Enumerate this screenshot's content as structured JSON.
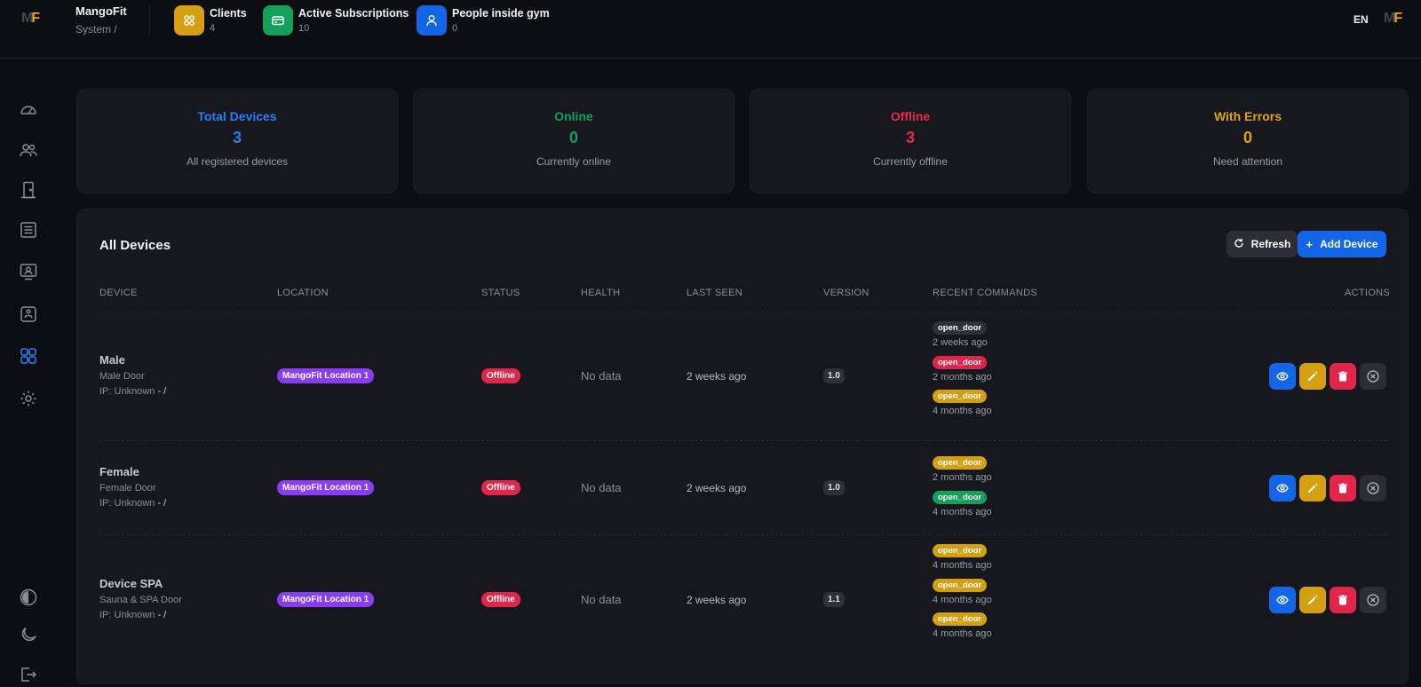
{
  "header": {
    "brand_name": "MangoFit",
    "breadcrumb": "System  /",
    "chips": [
      {
        "label": "Clients",
        "count": "4",
        "color": "#d4a012",
        "icon": "clients-icon"
      },
      {
        "label": "Active Subscriptions",
        "count": "10",
        "color": "#13a05a",
        "icon": "card-icon"
      },
      {
        "label": "People inside gym",
        "count": "0",
        "color": "#1366e8",
        "icon": "person-icon"
      }
    ],
    "language": "EN"
  },
  "sidebar": {
    "items": [
      {
        "icon": "dashboard-icon"
      },
      {
        "icon": "users-icon"
      },
      {
        "icon": "door-icon"
      },
      {
        "icon": "list-icon"
      },
      {
        "icon": "monitor-user-icon"
      },
      {
        "icon": "badge-icon"
      },
      {
        "icon": "devices-grid-icon",
        "active": true
      },
      {
        "icon": "gear-icon"
      }
    ],
    "bottom": [
      {
        "icon": "contrast-icon"
      },
      {
        "icon": "moon-icon"
      },
      {
        "icon": "logout-icon"
      }
    ]
  },
  "stats": [
    {
      "title": "Total Devices",
      "value": "3",
      "subtitle": "All registered devices",
      "color": "#2f7df6"
    },
    {
      "title": "Online",
      "value": "0",
      "subtitle": "Currently online",
      "color": "#13a05a"
    },
    {
      "title": "Offline",
      "value": "3",
      "subtitle": "Currently offline",
      "color": "#e8294d"
    },
    {
      "title": "With Errors",
      "value": "0",
      "subtitle": "Need attention",
      "color": "#e0a418"
    }
  ],
  "devices_panel": {
    "title": "All Devices",
    "refresh_label": "Refresh",
    "add_label": "Add Device",
    "columns": [
      "DEVICE",
      "LOCATION",
      "STATUS",
      "HEALTH",
      "LAST SEEN",
      "VERSION",
      "RECENT COMMANDS",
      "ACTIONS"
    ],
    "rows": [
      {
        "name": "Male",
        "desc": "Male Door",
        "ip_label": "IP: Unknown",
        "ip_suffix": "- /",
        "location": "MangoFit Location 1",
        "status": "Offline",
        "health": "No data",
        "last_seen": "2 weeks ago",
        "version": "1.0",
        "commands": [
          {
            "name": "open_door",
            "when": "2 weeks ago",
            "color": "#2f3139"
          },
          {
            "name": "open_door",
            "when": "2 months ago",
            "color": "#e0264a"
          },
          {
            "name": "open_door",
            "when": "4 months ago",
            "color": "#d4a012"
          }
        ]
      },
      {
        "name": "Female",
        "desc": "Female Door",
        "ip_label": "IP: Unknown",
        "ip_suffix": "- /",
        "location": "MangoFit Location 1",
        "status": "Offline",
        "health": "No data",
        "last_seen": "2 weeks ago",
        "version": "1.0",
        "commands": [
          {
            "name": "open_door",
            "when": "2 months ago",
            "color": "#d4a012"
          },
          {
            "name": "open_door",
            "when": "4 months ago",
            "color": "#13a05a"
          }
        ]
      },
      {
        "name": "Device SPA",
        "desc": "Sauna & SPA Door",
        "ip_label": "IP: Unknown",
        "ip_suffix": "- /",
        "location": "MangoFit Location 1",
        "status": "Offline",
        "health": "No data",
        "last_seen": "2 weeks ago",
        "version": "1.1",
        "commands": [
          {
            "name": "open_door",
            "when": "4 months ago",
            "color": "#d4a012"
          },
          {
            "name": "open_door",
            "when": "4 months ago",
            "color": "#d4a012"
          },
          {
            "name": "open_door",
            "when": "4 months ago",
            "color": "#d4a012"
          }
        ]
      }
    ]
  }
}
